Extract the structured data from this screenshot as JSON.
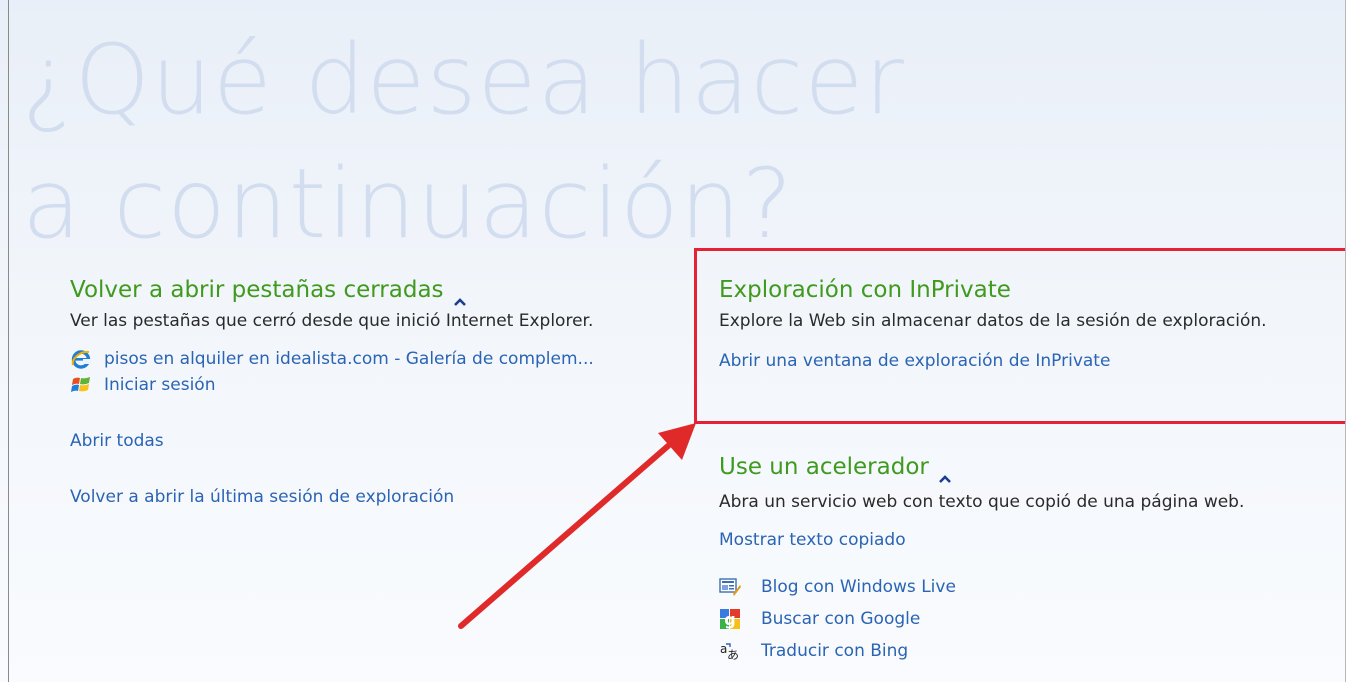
{
  "hero_title": "¿Qué desea hacer a continuación?",
  "reopen": {
    "title": "Volver a abrir pestañas cerradas",
    "description": "Ver las pestañas que cerró desde que inició Internet Explorer.",
    "tabs": [
      {
        "icon": "internet-explorer-icon",
        "label": "pisos en alquiler en idealista.com - Galería de complem..."
      },
      {
        "icon": "windows-flag-icon",
        "label": "Iniciar sesión"
      }
    ],
    "open_all": "Abrir todas",
    "reopen_session": "Volver a abrir la última sesión de exploración"
  },
  "inprivate": {
    "title": "Exploración con InPrivate",
    "description": "Explore la Web sin almacenar datos de la sesión de exploración.",
    "open_link": "Abrir una ventana de exploración de InPrivate"
  },
  "accelerator": {
    "title": "Use un acelerador",
    "description": "Abra un servicio web con texto que copió de una página web.",
    "show_copied": "Mostrar texto copiado",
    "items": [
      {
        "icon": "windows-live-blog-icon",
        "label": "Blog con Windows Live"
      },
      {
        "icon": "google-icon",
        "label": "Buscar con Google"
      },
      {
        "icon": "bing-translate-icon",
        "label": "Traducir con Bing"
      }
    ]
  },
  "colors": {
    "section_title": "#3f9a1e",
    "link": "#2a64b4",
    "highlight_box": "#e52235",
    "hero_text": "#d2deef"
  }
}
